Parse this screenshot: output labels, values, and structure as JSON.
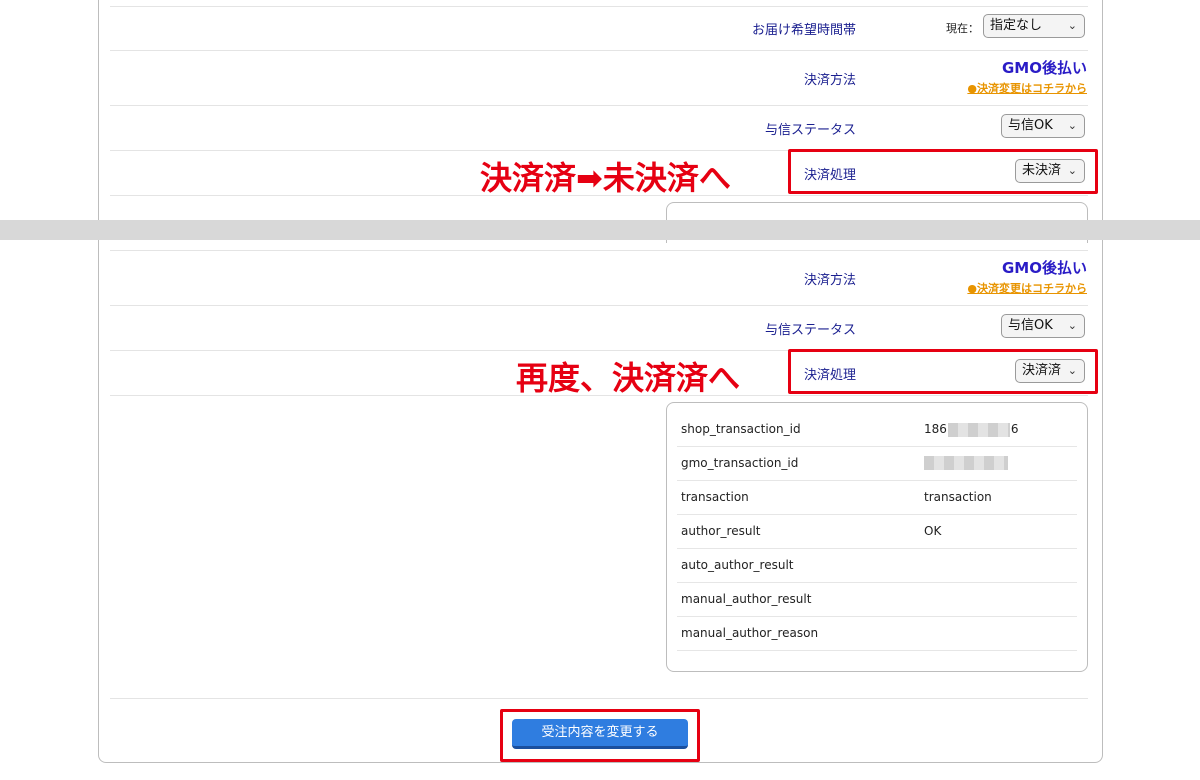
{
  "top": {
    "delivery_time_label": "お届け希望時間帯",
    "delivery_prefix": "現在：",
    "delivery_value": "指定なし",
    "payment_method_label": "決済方法",
    "payment_method_value": "GMO後払い",
    "payment_change_link": "●決済変更はコチラから",
    "credit_status_label": "与信ステータス",
    "credit_status_value": "与信OK",
    "settlement_label": "決済処理",
    "settlement_value": "未決済",
    "annotation": "決済済➡未決済へ"
  },
  "bottom": {
    "payment_method_label": "決済方法",
    "payment_method_value": "GMO後払い",
    "payment_change_link": "●決済変更はコチラから",
    "credit_status_label": "与信ステータス",
    "credit_status_value": "与信OK",
    "settlement_label": "決済処理",
    "settlement_value": "決済済",
    "annotation": "再度、決済済へ"
  },
  "info_table": [
    {
      "key": "shop_transaction_id",
      "value": "186",
      "value_suffix": "6"
    },
    {
      "key": "gmo_transaction_id",
      "value": ""
    },
    {
      "key": "transaction",
      "value": "transaction"
    },
    {
      "key": "author_result",
      "value": "OK"
    },
    {
      "key": "auto_author_result",
      "value": ""
    },
    {
      "key": "manual_author_result",
      "value": ""
    },
    {
      "key": "manual_author_reason",
      "value": ""
    }
  ],
  "submit_label": "受注内容を変更する",
  "colors": {
    "annotation_red": "#e60012",
    "label_blue": "#1a1f8f",
    "gmo_blue": "#2a1cc6",
    "link_orange": "#e89400",
    "button_blue": "#2f7de0"
  }
}
